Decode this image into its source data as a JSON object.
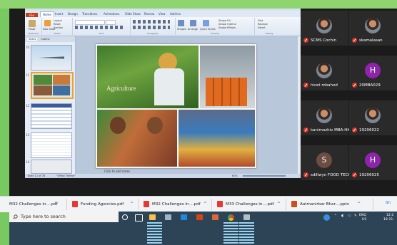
{
  "powerpoint": {
    "file_tab": "File",
    "tabs": [
      "Home",
      "Insert",
      "Design",
      "Transitions",
      "Animations",
      "Slide Show",
      "Review",
      "View",
      "Add-Ins"
    ],
    "ribbon_groups": [
      "Clipboard",
      "Slides",
      "Font",
      "Paragraph",
      "Drawing",
      "Editing"
    ],
    "ribbon_labels": {
      "paste": "Paste",
      "new_slide": "New Slide",
      "layout": "Layout",
      "reset": "Reset",
      "section": "Section",
      "shapes": "Shapes",
      "arrange": "Arrange",
      "quick_styles": "Quick Styles",
      "shape_fill": "Shape Fill",
      "shape_outline": "Shape Outline",
      "shape_effects": "Shape Effects",
      "find": "Find",
      "replace": "Replace",
      "select": "Select"
    },
    "panel_tabs": [
      "Slides",
      "Outline"
    ],
    "thumb_numbers": [
      "10",
      "11",
      "12",
      "13",
      "14"
    ],
    "slide_text": "Agriculture",
    "notes_placeholder": "Click to add notes",
    "status": {
      "slide_of": "Slide 11 of 76",
      "theme": "\"Office Theme\"",
      "zoom": "60%"
    }
  },
  "participants": [
    {
      "name": "SCMS Cochin",
      "kind": "photo"
    },
    {
      "name": "skamalasan",
      "kind": "photo"
    },
    {
      "name": "hicet mbahod",
      "kind": "photo"
    },
    {
      "name": "20MBA029",
      "kind": "letter",
      "letter": "H",
      "color": "#8e24aa"
    },
    {
      "name": "kanimozhiv MBA-HIC...",
      "kind": "photo"
    },
    {
      "name": "19206022",
      "kind": "photo"
    },
    {
      "name": "sdillwyn FOOD TECH...",
      "kind": "letter",
      "letter": "S",
      "color": "#6d4c41"
    },
    {
      "name": "19206025",
      "kind": "letter",
      "letter": "H",
      "color": "#8e24aa"
    }
  ],
  "downloads": [
    {
      "name": "M32 Challenges in....pdf",
      "type": "pdf"
    },
    {
      "name": "Funding Agencies.pdf",
      "type": "pdf"
    },
    {
      "name": "M32 Challenges in....pdf",
      "type": "pdf"
    },
    {
      "name": "M33 Challenges in....pdf",
      "type": "pdf"
    },
    {
      "name": "Aatmanirbar Bhar....pptx",
      "type": "pptx"
    }
  ],
  "show_all": "Sh",
  "taskbar": {
    "search_placeholder": "Type here to search",
    "lang": "ENG",
    "region": "US",
    "time": "12:2",
    "date": "18-11-"
  },
  "colors": {
    "mic_muted": "#d93025",
    "taskbar": "#2c4456",
    "ppt_file_tab": "#c2401a"
  }
}
